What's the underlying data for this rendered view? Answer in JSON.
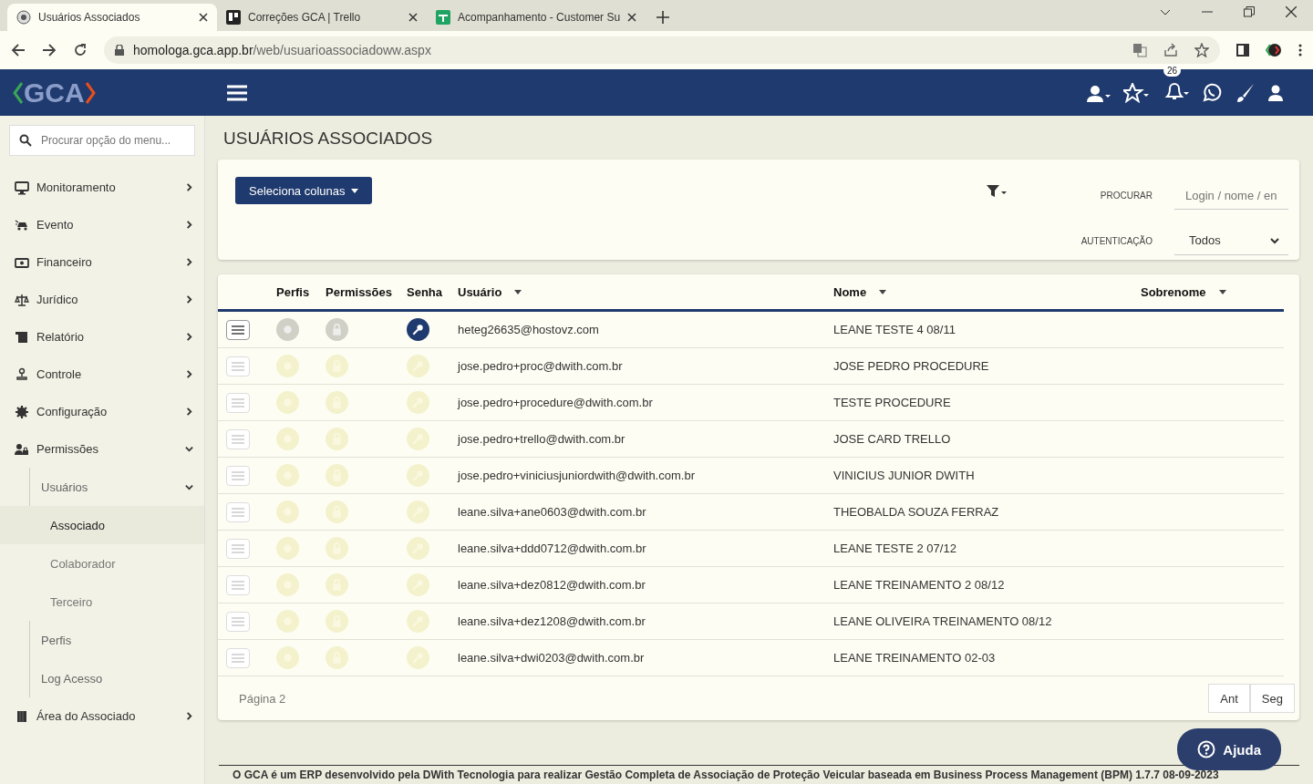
{
  "browser": {
    "tabs": [
      {
        "title": "Usuários Associados",
        "selected": true
      },
      {
        "title": "Correções GCA | Trello",
        "selected": false
      },
      {
        "title": "Acompanhamento - Customer Su",
        "selected": false
      }
    ],
    "url": {
      "host": "homologa.gca.app.br",
      "path": "/web/usuarioassociadoww.aspx"
    }
  },
  "header": {
    "logo": "GCA",
    "notification_count": "26"
  },
  "sidebar": {
    "search": {
      "placeholder": "Procurar opção do menu..."
    },
    "items": [
      {
        "label": "Monitoramento",
        "expanded": false
      },
      {
        "label": "Evento",
        "expanded": false
      },
      {
        "label": "Financeiro",
        "expanded": false
      },
      {
        "label": "Jurídico",
        "expanded": false
      },
      {
        "label": "Relatório",
        "expanded": false
      },
      {
        "label": "Controle",
        "expanded": false
      },
      {
        "label": "Configuração",
        "expanded": false
      },
      {
        "label": "Permissões",
        "expanded": true,
        "children": [
          {
            "label": "Usuários",
            "expanded": true,
            "children": [
              {
                "label": "Associado",
                "selected": true
              },
              {
                "label": "Colaborador",
                "selected": false
              },
              {
                "label": "Terceiro",
                "selected": false
              }
            ]
          },
          {
            "label": "Perfis"
          },
          {
            "label": "Log Acesso"
          }
        ]
      },
      {
        "label": "Área do Associado",
        "expanded": false
      }
    ]
  },
  "page": {
    "title": "USUÁRIOS ASSOCIADOS"
  },
  "filters": {
    "columns_button": "Seleciona colunas",
    "search_label": "PROCURAR",
    "search_placeholder": "Login / nome / en",
    "auth_label": "AUTENTICAÇÃO",
    "auth_value": "Todos"
  },
  "table": {
    "columns": [
      {
        "label": "Perfis",
        "sortable": false
      },
      {
        "label": "Permissões",
        "sortable": false
      },
      {
        "label": "Senha",
        "sortable": false
      },
      {
        "label": "Usuário",
        "sortable": true
      },
      {
        "label": "Nome",
        "sortable": true
      },
      {
        "label": "Sobrenome",
        "sortable": true
      }
    ],
    "rows": [
      {
        "user": "heteg26635@hostovz.com",
        "name": "LEANE TESTE 4 08/11",
        "hovered": true
      },
      {
        "user": "jose.pedro+proc@dwith.com.br",
        "name": "JOSE PEDRO PROCEDURE",
        "hovered": false
      },
      {
        "user": "jose.pedro+procedure@dwith.com.br",
        "name": "TESTE PROCEDURE",
        "hovered": false
      },
      {
        "user": "jose.pedro+trello@dwith.com.br",
        "name": "JOSE CARD TRELLO",
        "hovered": false
      },
      {
        "user": "jose.pedro+viniciusjuniordwith@dwith.com.br",
        "name": "VINICIUS JUNIOR DWITH",
        "hovered": false
      },
      {
        "user": "leane.silva+ane0603@dwith.com.br",
        "name": "THEOBALDA SOUZA FERRAZ",
        "hovered": false
      },
      {
        "user": "leane.silva+ddd0712@dwith.com.br",
        "name": "LEANE TESTE 2 07/12",
        "hovered": false
      },
      {
        "user": "leane.silva+dez0812@dwith.com.br",
        "name": "LEANE TREINAMENTO 2 08/12",
        "hovered": false
      },
      {
        "user": "leane.silva+dez1208@dwith.com.br",
        "name": "LEANE OLIVEIRA TREINAMENTO 08/12",
        "hovered": false
      },
      {
        "user": "leane.silva+dwi0203@dwith.com.br",
        "name": "LEANE TREINAMENTO 02-03",
        "hovered": false
      }
    ],
    "page_label": "Página 2",
    "prev": "Ant",
    "next": "Seg"
  },
  "help_button": "Ajuda",
  "footer": "O GCA é um ERP desenvolvido pela DWith Tecnologia para realizar Gestão Completa de Associação de Proteção Veicular baseada em Business Process Management (BPM) 1.7.7 08-09-2023"
}
